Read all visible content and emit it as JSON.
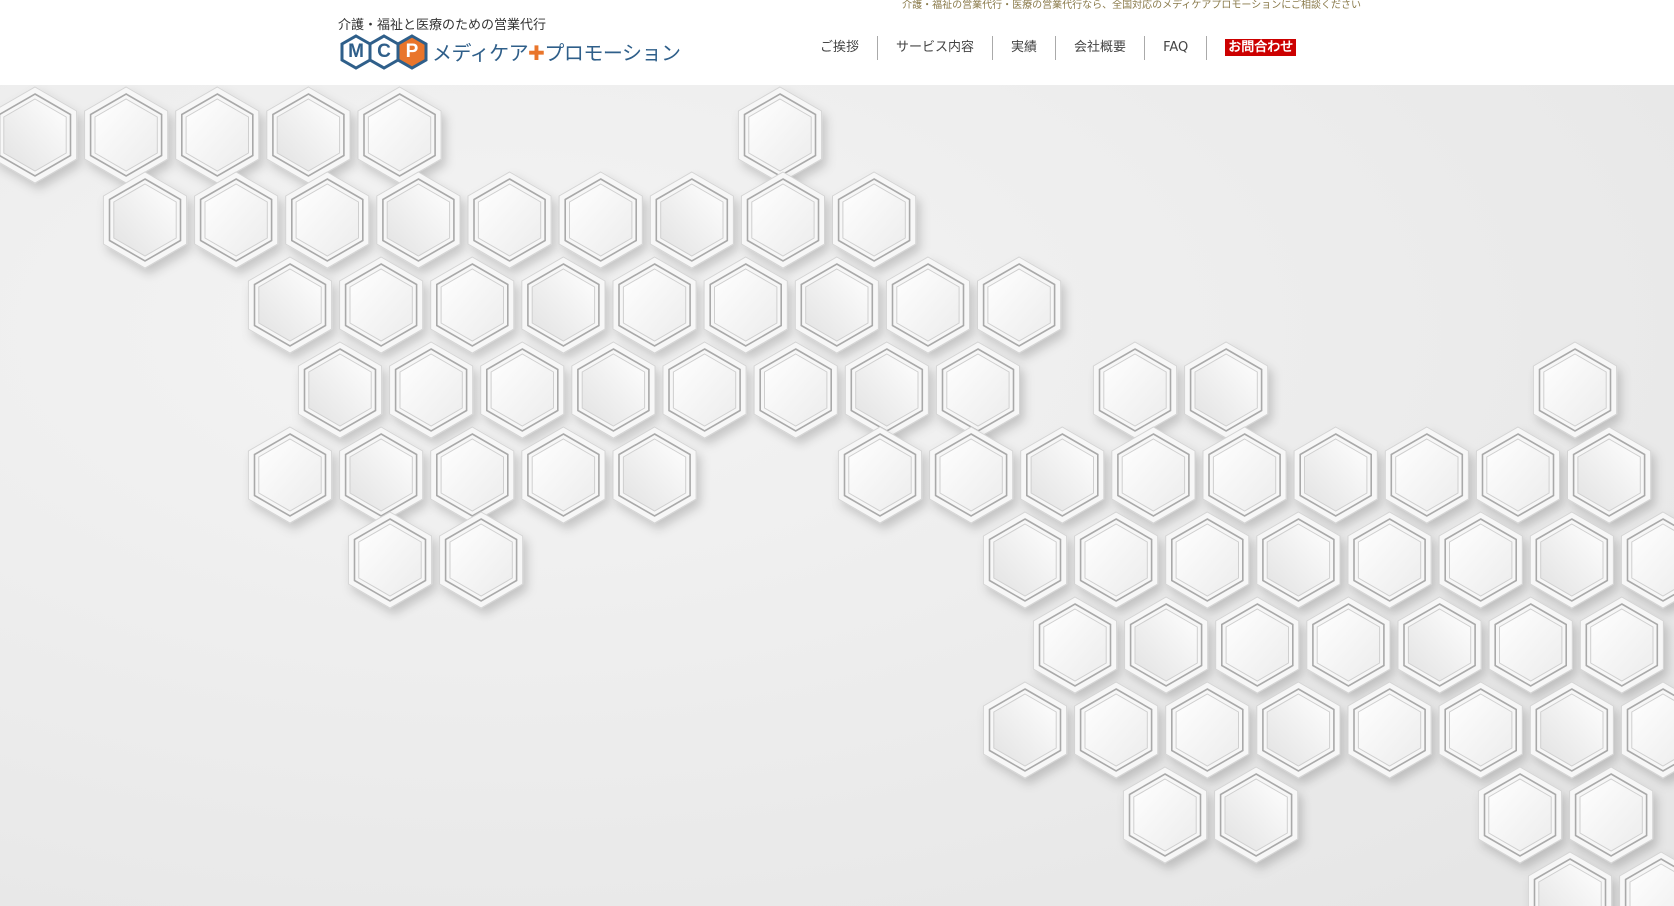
{
  "header": {
    "top_note": "介護・福祉の営業代行・医療の営業代行なら、全国対応のメディケアプロモーションにご相談ください",
    "tagline": "介護・福祉と医療のための営業代行",
    "logo": {
      "letters": [
        "M",
        "C",
        "P"
      ],
      "brand_before": "メディケア",
      "brand_plus": "✚",
      "brand_after": "プロモーション",
      "colors": {
        "primary": "#2f5f8a",
        "accent": "#e9752b"
      }
    }
  },
  "nav": {
    "items": [
      "ご挨拶",
      "サービス内容",
      "実績",
      "会社概要",
      "FAQ"
    ],
    "contact": "お問合わせ",
    "contact_color": "#cc0000"
  },
  "hero": {
    "description_icon": "hexagon-pattern"
  }
}
